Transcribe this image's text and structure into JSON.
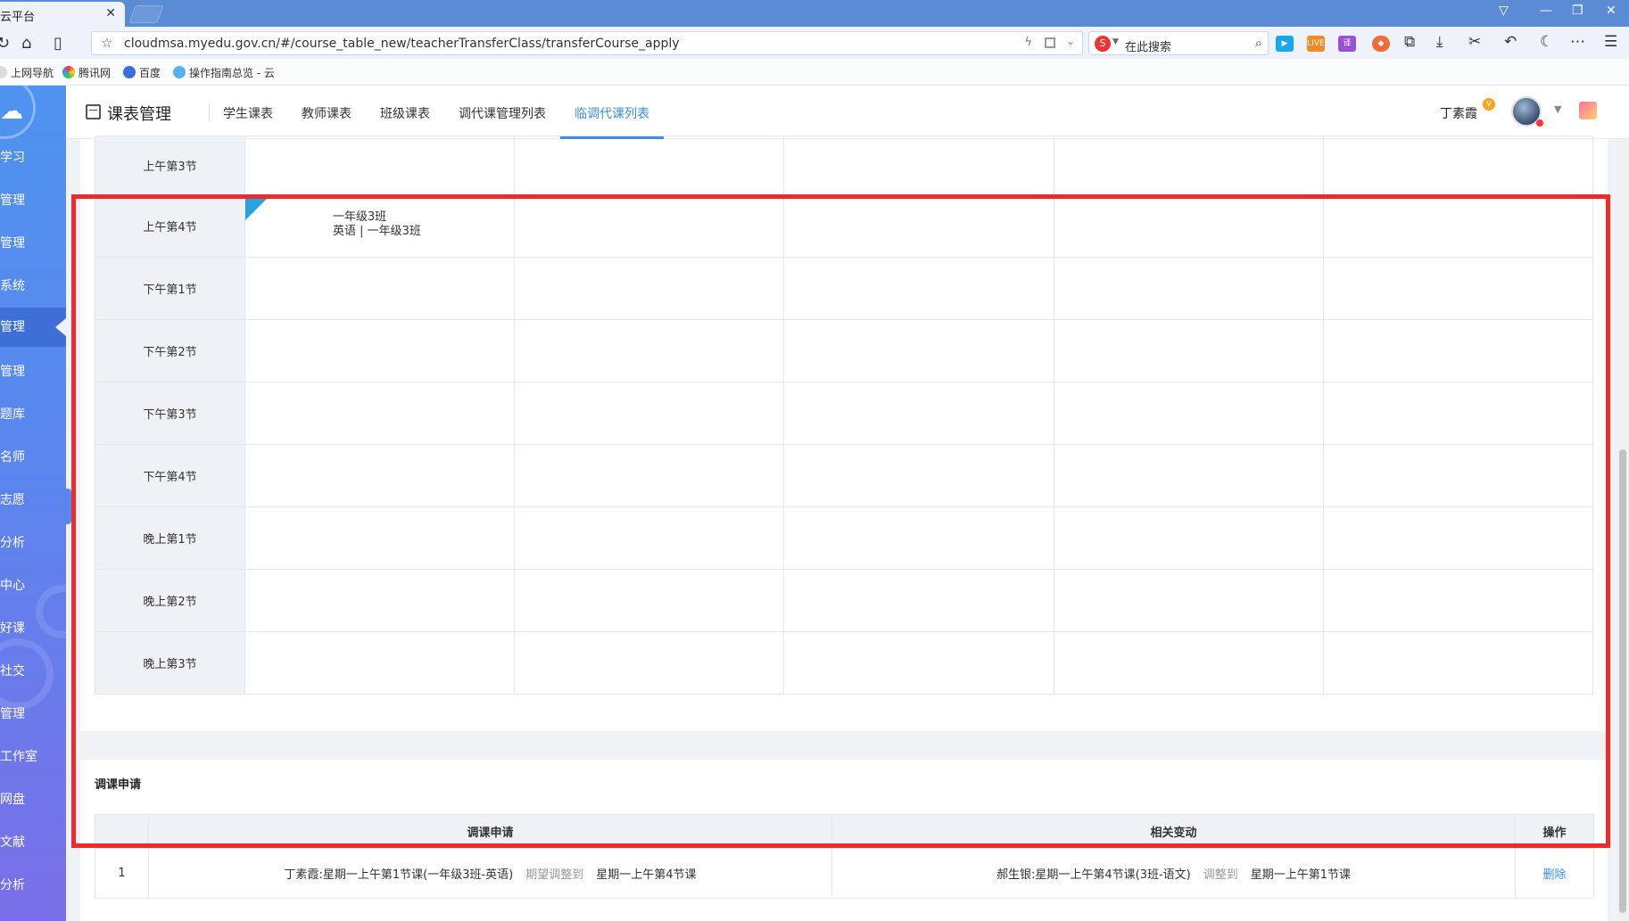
{
  "browser": {
    "tab_title": "云平台",
    "tab_close": "✕",
    "url": "cloudmsa.myedu.gov.cn/#/course_table_new/teacherTransferClass/transferCourse_apply",
    "search_placeholder": "在此搜索",
    "bookmarks": [
      "上网导航",
      "腾讯网",
      "百度",
      "操作指南总览 - 云"
    ]
  },
  "sidebar": {
    "items": [
      "学习",
      "管理",
      "管理",
      "系统",
      "管理",
      "管理",
      "题库",
      "名师",
      "志愿",
      "分析",
      "中心",
      "好课",
      "社交",
      "管理",
      "工作室",
      "网盘",
      "文献",
      "分析"
    ],
    "active_index": 4
  },
  "header": {
    "module_title": "课表管理",
    "tabs": [
      "学生课表",
      "教师课表",
      "班级课表",
      "调代课管理列表",
      "临调代课列表"
    ],
    "active_tab": 4,
    "user_name": "丁素霞",
    "user_badge": "V"
  },
  "timetable": {
    "periods": [
      "上午第3节",
      "上午第4节",
      "下午第1节",
      "下午第2节",
      "下午第3节",
      "下午第4节",
      "晚上第1节",
      "晚上第2节",
      "晚上第3节"
    ],
    "marked_cell": {
      "class_line": "一年级3班",
      "course_line": "英语 | 一年级3班"
    }
  },
  "apply_section": {
    "title": "调课申请",
    "columns": [
      "",
      "调课申请",
      "相关变动",
      "操作"
    ],
    "rows": [
      {
        "index": "1",
        "apply_from": "丁素霞:星期一上午第1节课(一年级3班-英语)",
        "apply_verb": "期望调整到",
        "apply_to": "星期一上午第4节课",
        "change_from": "郝生银:星期一上午第4节课(3班-语文)",
        "change_verb": "调整到",
        "change_to": "星期一上午第1节课",
        "action": "删除"
      }
    ]
  },
  "colors": {
    "accent": "#3a8ee6",
    "highlight_frame": "#ee2a2a",
    "cell_marker": "#29a0e0"
  }
}
